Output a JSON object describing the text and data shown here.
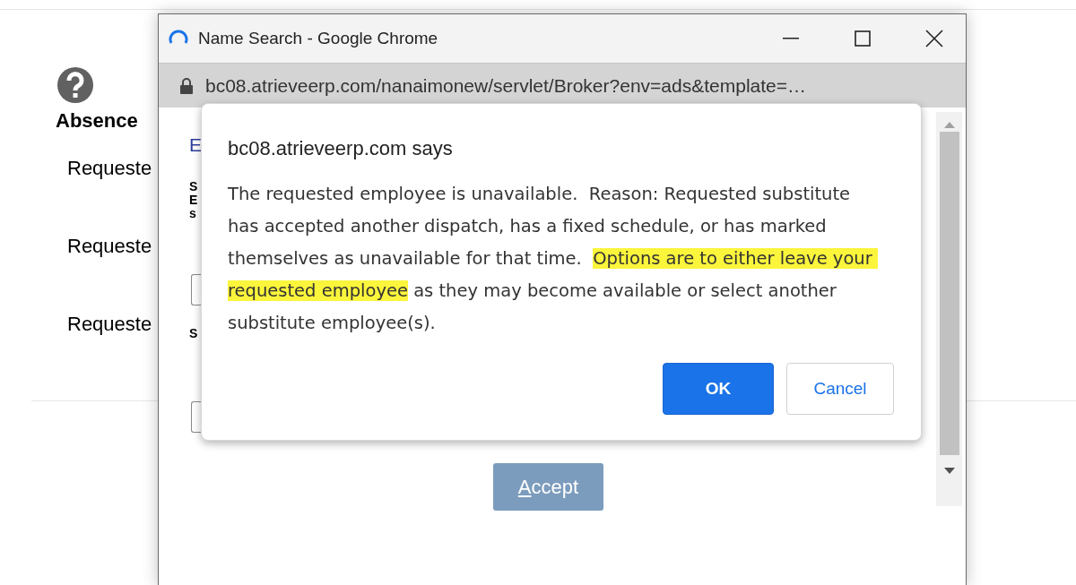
{
  "background_page": {
    "heading": "Absence",
    "rows": [
      "Requeste",
      "Requeste",
      "Requeste"
    ]
  },
  "popup_window": {
    "title": "Name Search - Google Chrome",
    "url": "bc08.atrieveerp.com/nanaimonew/servlet/Broker?env=ads&template=…",
    "content": {
      "link": "E",
      "label_lines": [
        "S",
        "E",
        "s"
      ],
      "second_label": "S",
      "accept_button": "Accept"
    }
  },
  "dialog": {
    "title": "bc08.atrieveerp.com says",
    "message": [
      {
        "text": "The requested employee is unavailable.  Reason: Requested substitute has accepted another dispatch, has a fixed schedule, or has marked themselves as unavailable for that time.  ",
        "highlighted": false
      },
      {
        "text": "Options are to either leave your requested employee",
        "highlighted": true
      },
      {
        "text": " as they may become available or select another substitute employee(s).",
        "highlighted": false
      }
    ],
    "buttons": [
      {
        "label": "OK",
        "primary": true
      },
      {
        "label": "Cancel",
        "primary": false
      }
    ]
  }
}
